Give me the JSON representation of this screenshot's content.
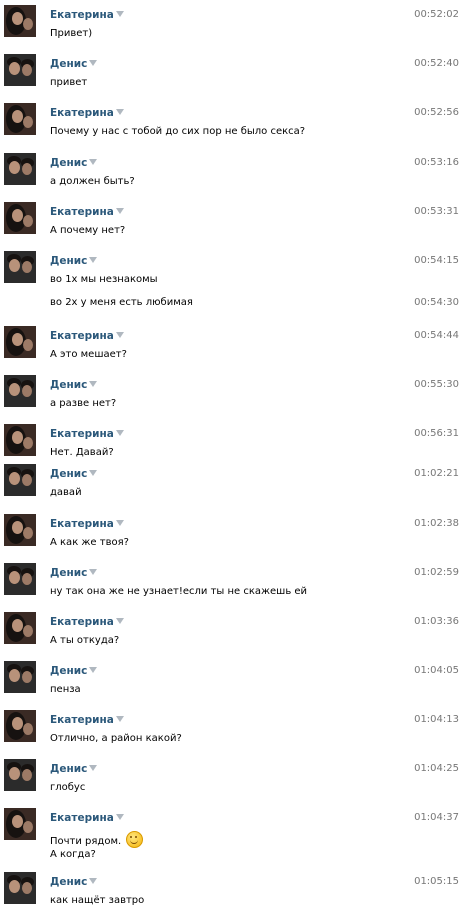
{
  "messages": [
    {
      "author": "Екатерина",
      "time": "00:52:02",
      "text": "Привет)",
      "avatar": "ekaterina"
    },
    {
      "author": "Денис",
      "time": "00:52:40",
      "text": "привет",
      "avatar": "denis"
    },
    {
      "author": "Екатерина",
      "time": "00:52:56",
      "text": "Почему у нас с тобой до сих пор не было секса?",
      "avatar": "ekaterina"
    },
    {
      "author": "Денис",
      "time": "00:53:16",
      "text": "а должен быть?",
      "avatar": "denis"
    },
    {
      "author": "Екатерина",
      "time": "00:53:31",
      "text": "А почему нет?",
      "avatar": "ekaterina"
    },
    {
      "author": "Денис",
      "time": "00:54:15",
      "text": "во 1х мы незнакомы",
      "avatar": "denis"
    },
    {
      "continuation": true,
      "time": "00:54:30",
      "text": "во 2х у меня есть любимая"
    },
    {
      "author": "Екатерина",
      "time": "00:54:44",
      "text": "А это мешает?",
      "avatar": "ekaterina"
    },
    {
      "author": "Денис",
      "time": "00:55:30",
      "text": "а разве нет?",
      "avatar": "denis"
    },
    {
      "author": "Екатерина",
      "time": "00:56:31",
      "text": "Нет. Давай?",
      "avatar": "ekaterina"
    },
    {
      "author": "Денис",
      "time": "01:02:21",
      "text": "давай",
      "avatar": "denis"
    },
    {
      "author": "Екатерина",
      "time": "01:02:38",
      "text": "А как же твоя?",
      "avatar": "ekaterina"
    },
    {
      "author": "Денис",
      "time": "01:02:59",
      "text": "ну так она же не узнает!если ты не скажешь ей",
      "avatar": "denis"
    },
    {
      "author": "Екатерина",
      "time": "01:03:36",
      "text": "А ты откуда?",
      "avatar": "ekaterina"
    },
    {
      "author": "Денис",
      "time": "01:04:05",
      "text": "пенза",
      "avatar": "denis"
    },
    {
      "author": "Екатерина",
      "time": "01:04:13",
      "text": "Отлично, а район какой?",
      "avatar": "ekaterina"
    },
    {
      "author": "Денис",
      "time": "01:04:25",
      "text": "глобус",
      "avatar": "denis"
    },
    {
      "author": "Екатерина",
      "time": "01:04:37",
      "text": "Почти рядом.",
      "text2": "А когда?",
      "emoji": "smile-icon",
      "avatar": "ekaterina"
    },
    {
      "author": "Денис",
      "time": "01:05:15",
      "text": "как нащёт завтро",
      "avatar": "denis"
    }
  ],
  "colors": {
    "author": "#2b587a",
    "time": "#777777",
    "text": "#000000"
  }
}
